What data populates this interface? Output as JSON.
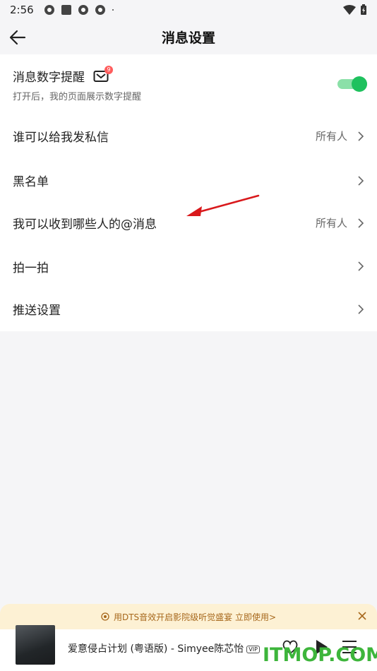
{
  "status_bar": {
    "time": "2:56"
  },
  "header": {
    "title": "消息设置"
  },
  "settings": {
    "message_badge": {
      "label": "消息数字提醒",
      "description": "打开后，我的页面展示数字提醒",
      "badge_count": "9",
      "enabled": true
    },
    "rows": [
      {
        "label": "谁可以给我发私信",
        "value": "所有人"
      },
      {
        "label": "黑名单",
        "value": ""
      },
      {
        "label": "我可以收到哪些人的@消息",
        "value": "所有人"
      },
      {
        "label": "拍一拍",
        "value": ""
      },
      {
        "label": "推送设置",
        "value": ""
      }
    ]
  },
  "banner": {
    "text": "用DTS音效开启影院级听觉盛宴  立即使用>"
  },
  "player": {
    "song": "爱意侵占计划 (粤语版) - Simyee陈芯怡",
    "vip": "VIP"
  },
  "watermark": "ITMOP.COM",
  "colors": {
    "toggle_on": "#1fc15e",
    "badge": "#ff5d5d",
    "annotation_arrow": "#d9191c",
    "banner_text": "#a7681c",
    "watermark": "#3db53b"
  }
}
